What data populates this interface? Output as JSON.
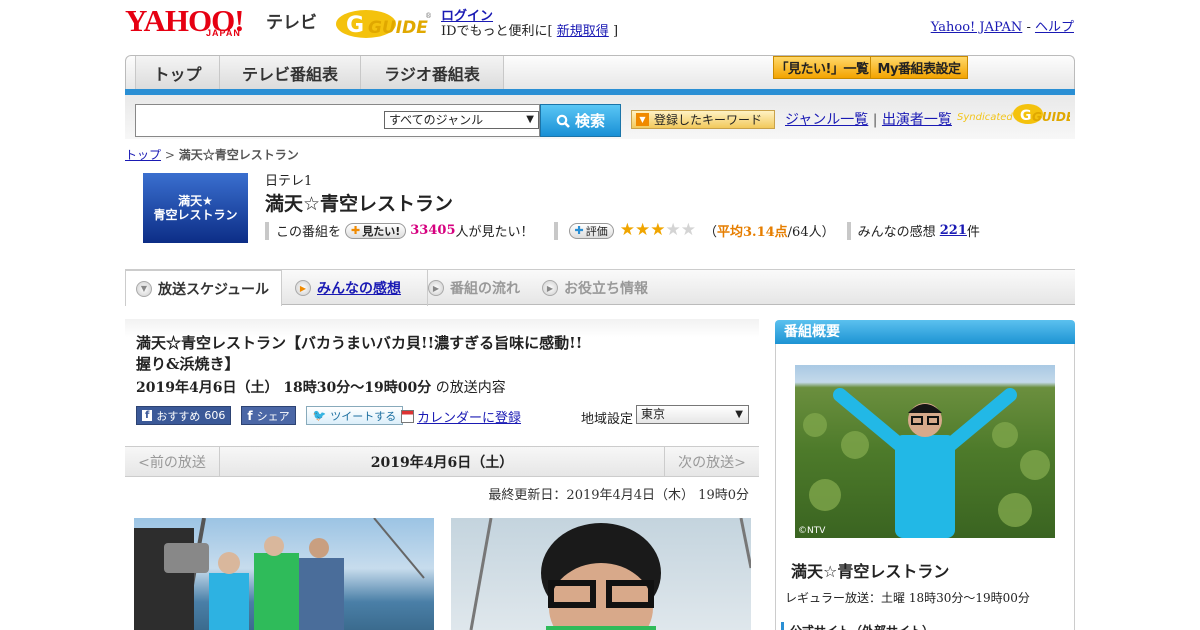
{
  "header": {
    "yahoo_logo": "YAHOO!",
    "japan": "JAPAN",
    "tv_label": "テレビ",
    "gguide_logo": "GUIDE",
    "login": "ログイン",
    "login_prompt": "IDでもっと便利に[",
    "signup": "新規取得",
    "login_suffix": "]",
    "yahoo_japan_link": "Yahoo! JAPAN",
    "sep": " - ",
    "help_link": "ヘルプ"
  },
  "nav": {
    "tabs": [
      "トップ",
      "テレビ番組表",
      "ラジオ番組表"
    ],
    "mitai_list": "「見たい!」一覧",
    "my_settings": "My番組表設定"
  },
  "search": {
    "placeholder": "",
    "genre": "すべてのジャンル",
    "button": "検索",
    "keyword_button": "登録したキーワード",
    "genre_list": "ジャンル一覧",
    "divider": "|",
    "performer_list": "出演者一覧",
    "syndicated": "Syndicated",
    "syndicated_logo": "GUIDE"
  },
  "breadcrumb": {
    "top": "トップ",
    "sep": " > ",
    "current": "満天☆青空レストラン"
  },
  "program": {
    "thumb_line1": "満天★",
    "thumb_line2": "青空レストラン",
    "channel": "日テレ1",
    "title": "満天☆青空レストラン",
    "mitai_prefix": "この番組を",
    "mitai_button": "見たい!",
    "mitai_count": "33405",
    "mitai_suffix": "人が見たい！",
    "rating_button": "評価",
    "rating_value": 3.14,
    "rating_open": "（",
    "rating_avg_label": "平均3.14点",
    "rating_votes": "/64人）",
    "impressions_label": "みんなの感想",
    "impressions_count": "221",
    "impressions_unit": "件"
  },
  "tabs": [
    {
      "label": "放送スケジュール"
    },
    {
      "label": "みんなの感想"
    },
    {
      "label": "番組の流れ"
    },
    {
      "label": "お役立ち情報"
    }
  ],
  "episode": {
    "title": "満天☆青空レストラン【バカうまいバカ貝!!濃すぎる旨味に感動!!握り&浜焼き】",
    "datetime": "2019年4月6日（土） 18時30分～19時00分",
    "datetime_suffix": " の放送内容",
    "fb_recommend": "おすすめ",
    "fb_count": "606",
    "fb_share": "シェア",
    "tweet": "ツイートする",
    "calendar": "カレンダーに登録",
    "area_label": "地域設定",
    "area_value": "東京"
  },
  "datenav": {
    "prev": "<前の放送",
    "current": "2019年4月6日（土）",
    "next": "次の放送>",
    "updated": "最終更新日：2019年4月4日（木） 19時0分"
  },
  "sidebar": {
    "heading": "番組概要",
    "photo_credit": "©NTV",
    "title": "満天☆青空レストラン",
    "schedule": "レギュラー放送：土曜 18時30分～19時00分",
    "official_site": "公式サイト（外部サイト）"
  },
  "colors": {
    "brand_red": "#e60012",
    "accent_blue": "#2a8fd4",
    "mitai_pink": "#d6007f",
    "rating_orange": "#e67e00",
    "star_gold": "#f0a500"
  }
}
